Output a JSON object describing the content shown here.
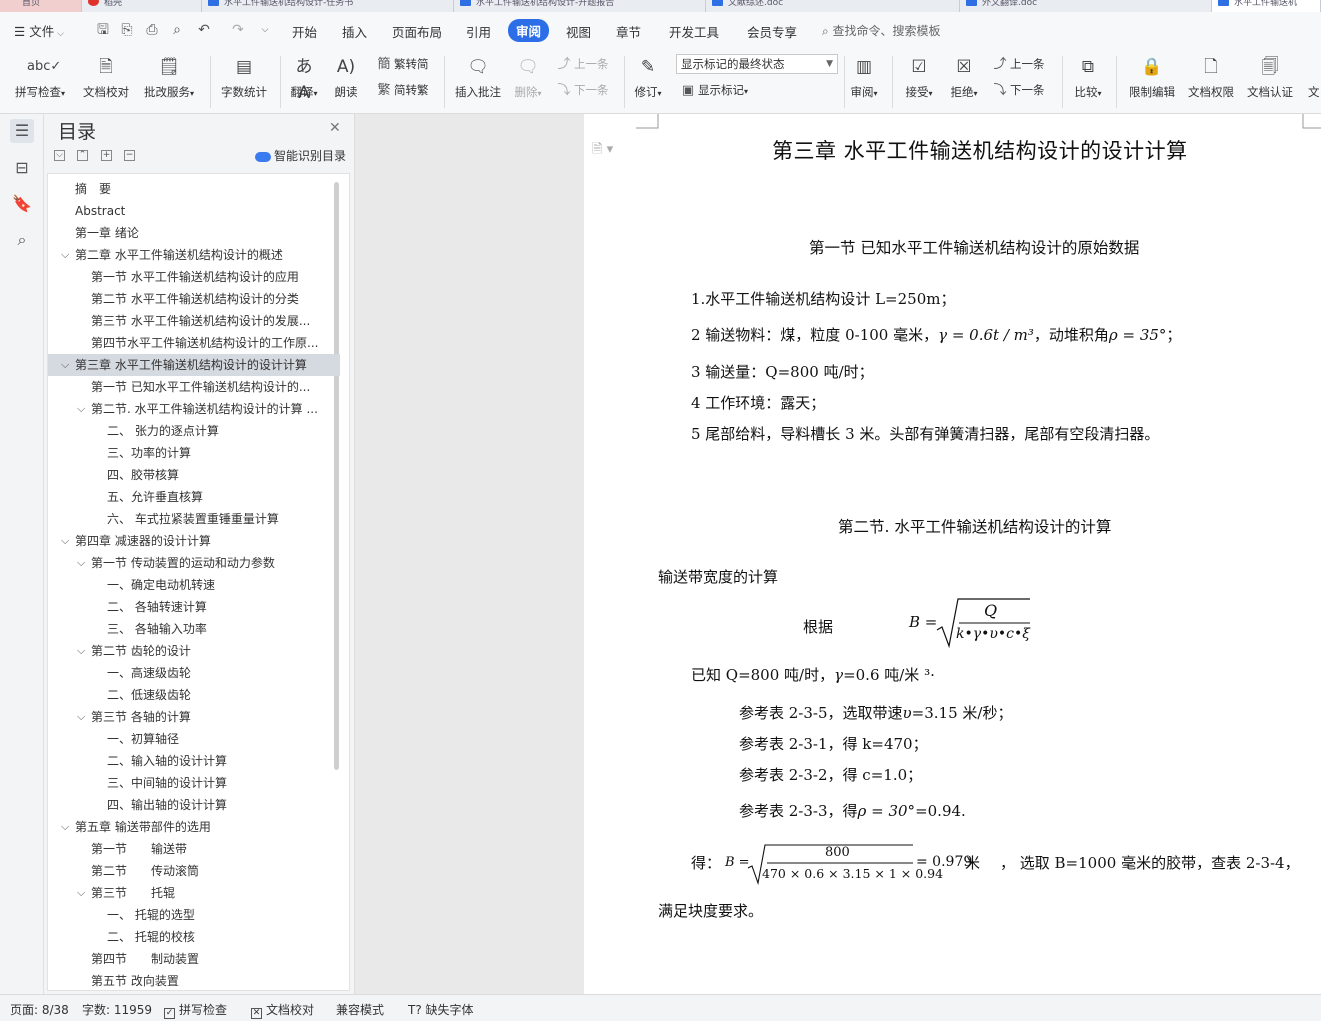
{
  "tabs": [
    {
      "label": "首页",
      "type": "home"
    },
    {
      "label": "稻壳",
      "type": "pdf"
    },
    {
      "label": "水平工件输送机结构设计-任务书",
      "type": "doc"
    },
    {
      "label": "水平工件输送机结构设计-开题报告",
      "type": "doc"
    },
    {
      "label": "文献综述.doc",
      "type": "doc"
    },
    {
      "label": "外文翻译.doc",
      "type": "doc"
    },
    {
      "label": "水平工件输送机",
      "type": "doc"
    }
  ],
  "menubar": {
    "file": "文件",
    "tabs": [
      "开始",
      "插入",
      "页面布局",
      "引用",
      "审阅",
      "视图",
      "章节",
      "开发工具",
      "会员专享"
    ],
    "active_tab": "审阅",
    "search": "查找命令、搜索模板"
  },
  "ribbon": {
    "spell": "拼写检查",
    "proof": "文档校对",
    "review_service": "批改服务",
    "wordcount": "字数统计",
    "translate": "翻译",
    "read_aloud": "朗读",
    "trad": "繁转简",
    "simp": "简转繁",
    "insert_comment": "插入批注",
    "delete": "删除",
    "prev_comment": "上一条",
    "next_comment": "下一条",
    "track": "修订",
    "markup_mode": "显示标记的最终状态",
    "show_markup": "显示标记",
    "review": "审阅",
    "accept": "接受",
    "reject": "拒绝",
    "prev_change": "上一条",
    "next_change": "下一条",
    "compare": "比较",
    "restrict": "限制编辑",
    "permission": "文档权限",
    "certify": "文档认证",
    "more": "文"
  },
  "nav": {
    "title": "目录",
    "smart": "智能识别目录",
    "items": [
      {
        "text": "摘　要",
        "level": 1,
        "arrow": ""
      },
      {
        "text": "Abstract",
        "level": 1,
        "arrow": ""
      },
      {
        "text": "第一章  绪论",
        "level": 1,
        "arrow": ""
      },
      {
        "text": "第二章  水平工件输送机结构设计的概述",
        "level": 1,
        "arrow": "⌵"
      },
      {
        "text": "第一节  水平工件输送机结构设计的应用",
        "level": 2,
        "arrow": ""
      },
      {
        "text": "第二节  水平工件输送机结构设计的分类",
        "level": 2,
        "arrow": ""
      },
      {
        "text": "第三节  水平工件输送机结构设计的发展...",
        "level": 2,
        "arrow": ""
      },
      {
        "text": "第四节水平工件输送机结构设计的工作原...",
        "level": 2,
        "arrow": ""
      },
      {
        "text": "第三章  水平工件输送机结构设计的设计计算",
        "level": 1,
        "arrow": "⌵",
        "selected": true
      },
      {
        "text": "第一节  已知水平工件输送机结构设计的...",
        "level": 2,
        "arrow": ""
      },
      {
        "text": "第二节. 水平工件输送机结构设计的计算  ...",
        "level": 2,
        "arrow": "⌵"
      },
      {
        "text": "二、  张力的逐点计算",
        "level": 3,
        "arrow": ""
      },
      {
        "text": "三、功率的计算",
        "level": 3,
        "arrow": ""
      },
      {
        "text": "四、胶带核算",
        "level": 3,
        "arrow": ""
      },
      {
        "text": "五、允许垂直核算",
        "level": 3,
        "arrow": ""
      },
      {
        "text": "六、  车式拉紧装置重锤重量计算",
        "level": 3,
        "arrow": ""
      },
      {
        "text": "第四章  减速器的设计计算",
        "level": 1,
        "arrow": "⌵"
      },
      {
        "text": "第一节  传动装置的运动和动力参数",
        "level": 2,
        "arrow": "⌵"
      },
      {
        "text": "一、确定电动机转速",
        "level": 3,
        "arrow": ""
      },
      {
        "text": "二、  各轴转速计算",
        "level": 3,
        "arrow": ""
      },
      {
        "text": "三、  各轴输入功率",
        "level": 3,
        "arrow": ""
      },
      {
        "text": "第二节  齿轮的设计",
        "level": 2,
        "arrow": "⌵"
      },
      {
        "text": "一、高速级齿轮",
        "level": 3,
        "arrow": ""
      },
      {
        "text": "二、低速级齿轮",
        "level": 3,
        "arrow": ""
      },
      {
        "text": "第三节  各轴的计算",
        "level": 2,
        "arrow": "⌵"
      },
      {
        "text": "一、初算轴径",
        "level": 3,
        "arrow": ""
      },
      {
        "text": "二、输入轴的设计计算",
        "level": 3,
        "arrow": ""
      },
      {
        "text": "三、中间轴的设计计算",
        "level": 3,
        "arrow": ""
      },
      {
        "text": "四、输出轴的设计计算",
        "level": 3,
        "arrow": ""
      },
      {
        "text": "第五章  输送带部件的选用",
        "level": 1,
        "arrow": "⌵"
      },
      {
        "text": "第一节　　输送带",
        "level": 2,
        "arrow": ""
      },
      {
        "text": "第二节　　传动滚筒",
        "level": 2,
        "arrow": ""
      },
      {
        "text": "第三节　　托辊",
        "level": 2,
        "arrow": "⌵"
      },
      {
        "text": "一、  托辊的选型",
        "level": 3,
        "arrow": ""
      },
      {
        "text": "二、  托辊的校核",
        "level": 3,
        "arrow": ""
      },
      {
        "text": "第四节　　制动装置",
        "level": 2,
        "arrow": ""
      },
      {
        "text": "第五节  改向装置",
        "level": 2,
        "arrow": ""
      }
    ]
  },
  "document": {
    "chapter_title": "第三章  水平工件输送机结构设计的设计计算",
    "section1_title": "第一节  已知水平工件输送机结构设计的原始数据",
    "p1": "1.水平工件输送机结构设计 L=250m；",
    "p2a": "2 输送物料：煤，粒度 0-100 毫米，",
    "p2_gamma": "γ = 0.6t / m³",
    "p2b": "，动堆积角",
    "p2_rho": "ρ = 35°",
    "p2c": "；",
    "p3": "3 输送量：Q=800 吨/时；",
    "p4": "4  工作环境：露天；",
    "p5": "5  尾部给料，导料槽长 3 米。头部有弹簧清扫器，尾部有空段清扫器。",
    "section2_title": "第二节. 水平工件输送机结构设计的计算",
    "p6": "输送带宽度的计算",
    "basis": "根据",
    "formula_lhs": "B =",
    "formula_num": "Q",
    "formula_den": "k•γ•υ•c•ξ",
    "p7a": "已知 Q=800 吨/时，",
    "p7_gamma": "γ",
    "p7b": "=0.6 吨/米 ³·",
    "p8": "参考表 2-3-5，选取带速",
    "p8_v": "υ",
    "p8b": "=3.15 米/秒；",
    "p9": "参考表 2-3-1，得 k=470；",
    "p10": "参考表 2-3-2，得 c=1.0；",
    "p11a": "参考表 2-3-3，得",
    "p11_rho": "ρ = 30°",
    "p11b": "=0.94.",
    "result_label": "得：",
    "result_lhs": "B =",
    "result_num": "800",
    "result_den": "470 × 0.6 × 3.15 × 1 × 0.94",
    "result_rhs": "= 0.979",
    "result_unit": "米",
    "result_tail": "，  选取 B=1000 毫米的胶带，查表 2-3-4，",
    "p12": "满足块度要求。"
  },
  "status": {
    "page": "页面: 8/38",
    "words": "字数: 11959",
    "spell": "拼写检查",
    "proof": "文档校对",
    "compat": "兼容模式",
    "missing_font": "缺失字体"
  },
  "colors": {
    "accent": "#2b6ee8",
    "selected_row": "#d5d9e0"
  }
}
